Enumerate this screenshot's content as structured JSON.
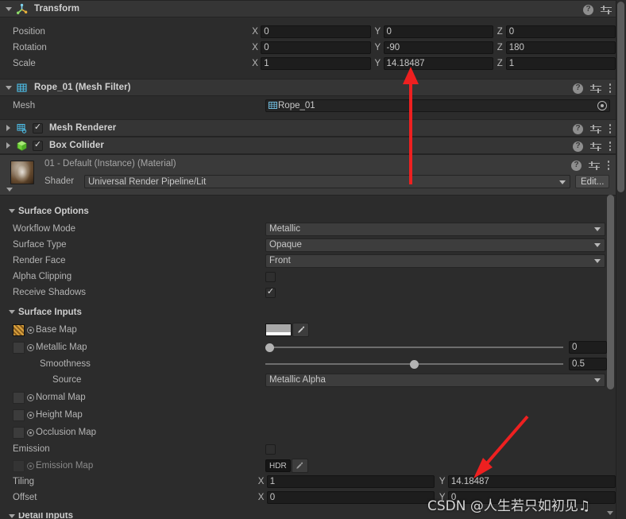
{
  "transform": {
    "title": "Transform",
    "icon": "transform-axis-icon",
    "rows": [
      {
        "label": "Position",
        "x": "0",
        "y": "0",
        "z": "0"
      },
      {
        "label": "Rotation",
        "x": "0",
        "y": "-90",
        "z": "180"
      },
      {
        "label": "Scale",
        "x": "1",
        "y": "14.18487",
        "z": "1"
      }
    ],
    "axis_labels": {
      "x": "X",
      "y": "Y",
      "z": "Z"
    }
  },
  "mesh_filter": {
    "title": "Rope_01 (Mesh Filter)",
    "icon": "mesh-filter-icon",
    "mesh_label": "Mesh",
    "mesh_value": "Rope_01"
  },
  "mesh_renderer": {
    "title": "Mesh Renderer",
    "icon": "mesh-renderer-icon",
    "enabled": true
  },
  "box_collider": {
    "title": "Box Collider",
    "icon": "box-collider-icon",
    "enabled": true
  },
  "material": {
    "title": "01 - Default (Instance) (Material)",
    "shader_label": "Shader",
    "shader_value": "Universal Render Pipeline/Lit",
    "edit_label": "Edit..."
  },
  "surface_options": {
    "title": "Surface Options",
    "rows": [
      {
        "label": "Workflow Mode",
        "type": "dropdown",
        "value": "Metallic"
      },
      {
        "label": "Surface Type",
        "type": "dropdown",
        "value": "Opaque"
      },
      {
        "label": "Render Face",
        "type": "dropdown",
        "value": "Front"
      },
      {
        "label": "Alpha Clipping",
        "type": "checkbox",
        "checked": false
      },
      {
        "label": "Receive Shadows",
        "type": "checkbox",
        "checked": true
      }
    ]
  },
  "surface_inputs": {
    "title": "Surface Inputs",
    "base_map": {
      "label": "Base Map",
      "has_texture": true,
      "color": "#a8a8a8"
    },
    "metallic_map": {
      "label": "Metallic Map",
      "value": "0",
      "slider_pct": 0
    },
    "smoothness": {
      "label": "Smoothness",
      "value": "0.5",
      "slider_pct": 50
    },
    "source": {
      "label": "Source",
      "value": "Metallic Alpha"
    },
    "normal_map": {
      "label": "Normal Map"
    },
    "height_map": {
      "label": "Height Map"
    },
    "occlusion_map": {
      "label": "Occlusion Map"
    },
    "emission": {
      "label": "Emission",
      "checked": false
    },
    "emission_map": {
      "label": "Emission Map",
      "hdr_label": "HDR"
    },
    "tiling": {
      "label": "Tiling",
      "x": "1",
      "y": "14.18487"
    },
    "offset": {
      "label": "Offset",
      "x": "0",
      "y": "0"
    },
    "axis_labels": {
      "x": "X",
      "y": "Y"
    }
  },
  "detail_inputs": {
    "title": "Detail Inputs"
  },
  "annotations": {
    "arrow_color": "#ee2020",
    "arrow_top_name": "arrow-pointing-to-scale-y",
    "arrow_bottom_name": "arrow-pointing-to-tiling-y"
  },
  "watermark": {
    "text": "CSDN @人生若只如初见♫"
  }
}
